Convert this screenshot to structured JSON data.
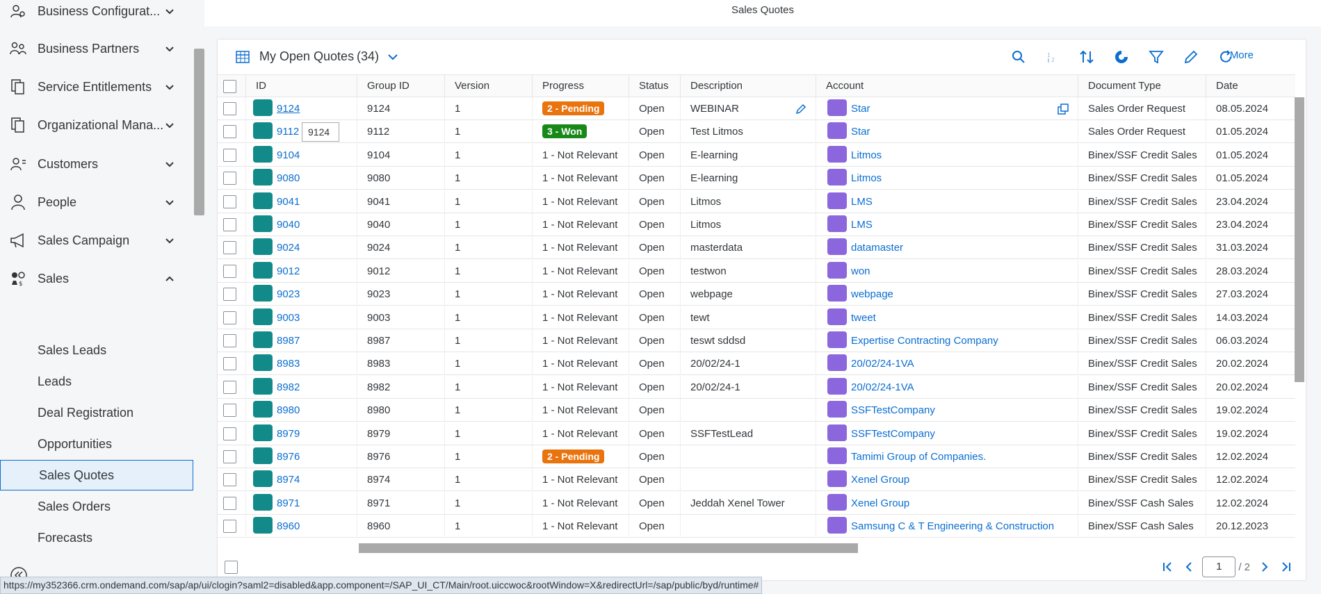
{
  "app": {
    "page_title": "Sales Quotes"
  },
  "sidebar": {
    "groups": [
      {
        "label": "Business Configurat...",
        "icon": "settings-people-icon",
        "expanded": false
      },
      {
        "label": "Business Partners",
        "icon": "partners-icon",
        "expanded": false
      },
      {
        "label": "Service Entitlements",
        "icon": "copy-icon",
        "expanded": false
      },
      {
        "label": "Organizational Mana...",
        "icon": "copy-icon",
        "expanded": false
      },
      {
        "label": "Customers",
        "icon": "customers-icon",
        "expanded": false
      },
      {
        "label": "People",
        "icon": "person-icon",
        "expanded": false
      },
      {
        "label": "Sales Campaign",
        "icon": "megaphone-icon",
        "expanded": false
      },
      {
        "label": "Sales",
        "icon": "sales-icon",
        "expanded": true
      }
    ],
    "sales_items": [
      "Sales Leads",
      "Leads",
      "Deal Registration",
      "Opportunities",
      "Sales Quotes",
      "Sales Orders",
      "Forecasts"
    ],
    "selected": "Sales Quotes"
  },
  "view": {
    "title": "My Open Quotes",
    "count": "(34)",
    "more_label": "More"
  },
  "table": {
    "columns": [
      "ID",
      "Group ID",
      "Version",
      "Progress",
      "Status",
      "Description",
      "Account",
      "Document Type",
      "Date"
    ],
    "rows": [
      {
        "id": "9124",
        "group": "9124",
        "version": "1",
        "progress": "2 - Pending",
        "status": "Open",
        "desc": "WEBINAR",
        "account": "Star",
        "doctype": "Sales Order Request",
        "date": "08.05.2024"
      },
      {
        "id": "9112",
        "group": "9112",
        "version": "1",
        "progress": "3 - Won",
        "status": "Open",
        "desc": "Test Litmos",
        "account": "Star",
        "doctype": "Sales Order Request",
        "date": "01.05.2024"
      },
      {
        "id": "9104",
        "group": "9104",
        "version": "1",
        "progress": "1 - Not Relevant",
        "status": "Open",
        "desc": "E-learning",
        "account": "Litmos",
        "doctype": "Binex/SSF Credit Sales",
        "date": "01.05.2024"
      },
      {
        "id": "9080",
        "group": "9080",
        "version": "1",
        "progress": "1 - Not Relevant",
        "status": "Open",
        "desc": "E-learning",
        "account": "Litmos",
        "doctype": "Binex/SSF Credit Sales",
        "date": "01.05.2024"
      },
      {
        "id": "9041",
        "group": "9041",
        "version": "1",
        "progress": "1 - Not Relevant",
        "status": "Open",
        "desc": "Litmos",
        "account": "LMS",
        "doctype": "Binex/SSF Credit Sales",
        "date": "23.04.2024"
      },
      {
        "id": "9040",
        "group": "9040",
        "version": "1",
        "progress": "1 - Not Relevant",
        "status": "Open",
        "desc": "Litmos",
        "account": "LMS",
        "doctype": "Binex/SSF Credit Sales",
        "date": "23.04.2024"
      },
      {
        "id": "9024",
        "group": "9024",
        "version": "1",
        "progress": "1 - Not Relevant",
        "status": "Open",
        "desc": "masterdata",
        "account": "datamaster",
        "doctype": "Binex/SSF Credit Sales",
        "date": "31.03.2024"
      },
      {
        "id": "9012",
        "group": "9012",
        "version": "1",
        "progress": "1 - Not Relevant",
        "status": "Open",
        "desc": "testwon",
        "account": "won",
        "doctype": "Binex/SSF Credit Sales",
        "date": "28.03.2024"
      },
      {
        "id": "9023",
        "group": "9023",
        "version": "1",
        "progress": "1 - Not Relevant",
        "status": "Open",
        "desc": "webpage",
        "account": "webpage",
        "doctype": "Binex/SSF Credit Sales",
        "date": "27.03.2024"
      },
      {
        "id": "9003",
        "group": "9003",
        "version": "1",
        "progress": "1 - Not Relevant",
        "status": "Open",
        "desc": "tewt",
        "account": "tweet",
        "doctype": "Binex/SSF Credit Sales",
        "date": "14.03.2024"
      },
      {
        "id": "8987",
        "group": "8987",
        "version": "1",
        "progress": "1 - Not Relevant",
        "status": "Open",
        "desc": "teswt sddsd",
        "account": "Expertise Contracting Company",
        "doctype": "Binex/SSF Credit Sales",
        "date": "06.03.2024"
      },
      {
        "id": "8983",
        "group": "8983",
        "version": "1",
        "progress": "1 - Not Relevant",
        "status": "Open",
        "desc": "20/02/24-1",
        "account": "20/02/24-1VA",
        "doctype": "Binex/SSF Credit Sales",
        "date": "20.02.2024"
      },
      {
        "id": "8982",
        "group": "8982",
        "version": "1",
        "progress": "1 - Not Relevant",
        "status": "Open",
        "desc": "20/02/24-1",
        "account": "20/02/24-1VA",
        "doctype": "Binex/SSF Credit Sales",
        "date": "20.02.2024"
      },
      {
        "id": "8980",
        "group": "8980",
        "version": "1",
        "progress": "1 - Not Relevant",
        "status": "Open",
        "desc": "",
        "account": "SSFTestCompany",
        "doctype": "Binex/SSF Credit Sales",
        "date": "19.02.2024"
      },
      {
        "id": "8979",
        "group": "8979",
        "version": "1",
        "progress": "1 - Not Relevant",
        "status": "Open",
        "desc": "SSFTestLead",
        "account": "SSFTestCompany",
        "doctype": "Binex/SSF Credit Sales",
        "date": "19.02.2024"
      },
      {
        "id": "8976",
        "group": "8976",
        "version": "1",
        "progress": "2 - Pending",
        "status": "Open",
        "desc": "",
        "account": "Tamimi Group of Companies.",
        "doctype": "Binex/SSF Credit Sales",
        "date": "12.02.2024"
      },
      {
        "id": "8974",
        "group": "8974",
        "version": "1",
        "progress": "1 - Not Relevant",
        "status": "Open",
        "desc": "",
        "account": "Xenel Group",
        "doctype": "Binex/SSF Credit Sales",
        "date": "12.02.2024"
      },
      {
        "id": "8971",
        "group": "8971",
        "version": "1",
        "progress": "1 - Not Relevant",
        "status": "Open",
        "desc": "Jeddah Xenel Tower",
        "account": "Xenel Group",
        "doctype": "Binex/SSF Cash Sales",
        "date": "12.02.2024"
      },
      {
        "id": "8960",
        "group": "8960",
        "version": "1",
        "progress": "1 - Not Relevant",
        "status": "Open",
        "desc": "",
        "account": "Samsung C & T Engineering & Construction",
        "doctype": "Binex/SSF Cash Sales",
        "date": "20.12.2023"
      }
    ]
  },
  "tooltip": "9124",
  "pager": {
    "current": "1",
    "total": "/ 2"
  },
  "status_url": "https://my352366.crm.ondemand.com/sap/ap/ui/clogin?saml2=disabled&app.component=/SAP_UI_CT/Main/root.uiccwoc&rootWindow=X&redirectUrl=/sap/public/byd/runtime#",
  "colors": {
    "accent": "#0a6ed1",
    "id_icon": "#138a8a",
    "account_icon": "#8b66dd",
    "pending": "#e9730c",
    "won": "#188918"
  }
}
